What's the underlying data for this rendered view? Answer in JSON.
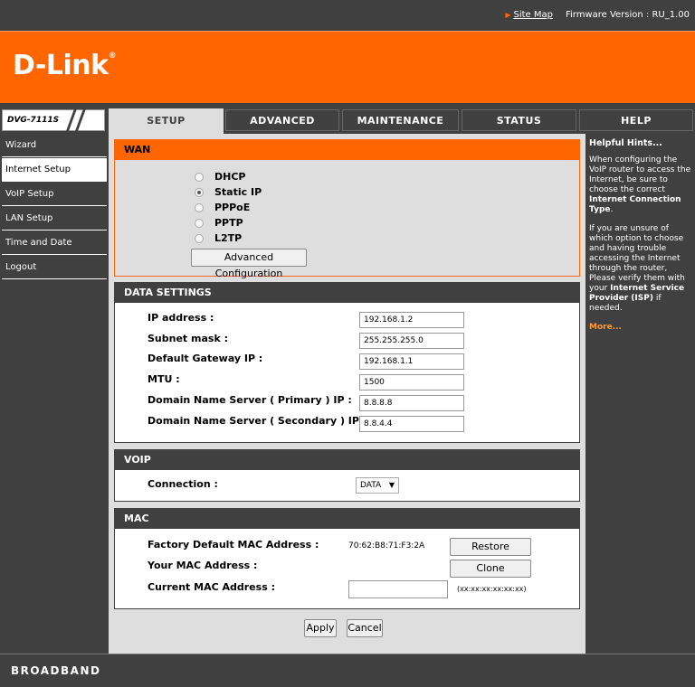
{
  "top": {
    "sitemap": "Site Map",
    "firmware": "Firmware Version : RU_1.00"
  },
  "brand": {
    "logo": "D-Link",
    "model": "DVG-7111S"
  },
  "tabs": [
    {
      "label": "SETUP"
    },
    {
      "label": "ADVANCED"
    },
    {
      "label": "MAINTENANCE"
    },
    {
      "label": "STATUS"
    },
    {
      "label": "HELP"
    }
  ],
  "active_tab": "SETUP",
  "sidebar": {
    "items": [
      {
        "label": "Wizard"
      },
      {
        "label": "Internet Setup"
      },
      {
        "label": "VoIP Setup"
      },
      {
        "label": "LAN Setup"
      },
      {
        "label": "Time and Date"
      },
      {
        "label": "Logout"
      }
    ],
    "active": "Internet Setup"
  },
  "wan": {
    "title": "WAN",
    "options": [
      {
        "label": "DHCP",
        "selected": false
      },
      {
        "label": "Static IP",
        "selected": true
      },
      {
        "label": "PPPoE",
        "selected": false
      },
      {
        "label": "PPTP",
        "selected": false
      },
      {
        "label": "L2TP",
        "selected": false
      }
    ],
    "advanced_button": "Advanced Configuration"
  },
  "data_settings": {
    "title": "DATA SETTINGS",
    "fields": [
      {
        "label": "IP address :",
        "value": "192.168.1.2"
      },
      {
        "label": "Subnet mask :",
        "value": "255.255.255.0"
      },
      {
        "label": "Default Gateway IP :",
        "value": "192.168.1.1"
      },
      {
        "label": "MTU :",
        "value": "1500"
      },
      {
        "label": "Domain Name Server ( Primary ) IP :",
        "value": "8.8.8.8"
      },
      {
        "label": "Domain Name Server ( Secondary ) IP :",
        "value": "8.8.4.4"
      }
    ]
  },
  "voip": {
    "title": "VOIP",
    "connection_label": "Connection :",
    "connection_value": "DATA"
  },
  "mac": {
    "title": "MAC",
    "factory_label": "Factory Default MAC Address :",
    "factory_value": "70:62:B8:71:F3:2A",
    "your_label": "Your MAC Address :",
    "current_label": "Current MAC Address :",
    "current_value": "",
    "format_hint": "(xx:xx:xx:xx:xx:xx)",
    "restore_button": "Restore",
    "clone_button": "Clone"
  },
  "actions": {
    "apply": "Apply",
    "cancel": "Cancel"
  },
  "hints": {
    "title": "Helpful Hints...",
    "p1_text": "When configuring the VoIP router to access the Internet, be sure to choose the correct",
    "p1_bold": "Internet Connection Type",
    "p2_text": "If you are unsure of which option to choose and having trouble accessing the Internet through the router, Please verify them with your",
    "p2_bold": "Internet Service Provider (ISP)",
    "p2_tail": "if needed.",
    "more": "More..."
  },
  "footer": {
    "brand": "BROADBAND"
  },
  "colors": {
    "orange": "#ff6600",
    "dark": "#404040",
    "panel": "#dedede"
  }
}
